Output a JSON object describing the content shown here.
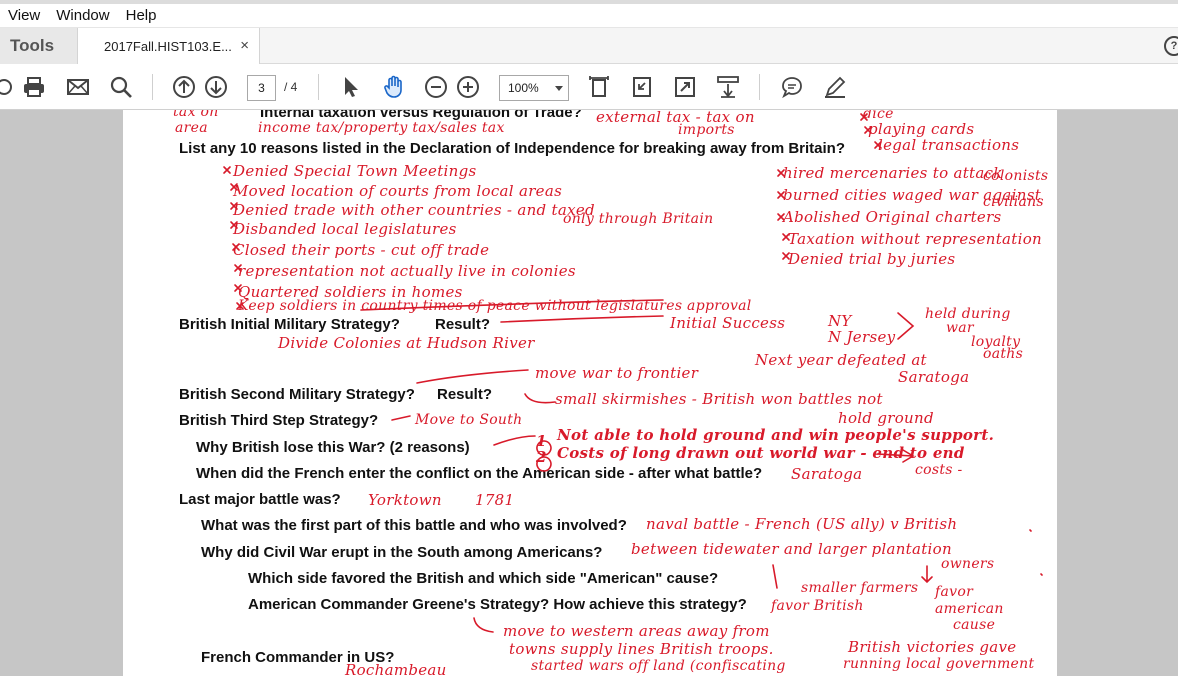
{
  "menu": [
    "View",
    "Window",
    "Help"
  ],
  "tabs": {
    "tools": "Tools",
    "document": "2017Fall.HIST103.E...",
    "close": "×",
    "help": "?"
  },
  "toolbar": {
    "page_current": "3",
    "page_sep": "/ 4",
    "zoom": "100%"
  },
  "icons": [
    "print-icon",
    "email-icon",
    "search-icon",
    "page-up-icon",
    "page-down-icon",
    "select-arrow-icon",
    "hand-tool-icon",
    "zoom-out-icon",
    "zoom-in-icon",
    "fit-page-icon",
    "rotate-icon",
    "full-screen-icon",
    "scroll-mode-icon",
    "comment-icon",
    "highlight-pen-icon"
  ],
  "questions": [
    "Internal taxation versus Regulation of Trade?",
    "List any 10 reasons listed in the Declaration of Independence for breaking away from Britain?",
    "British Initial Military Strategy?",
    "Result?",
    "British Second Military Strategy?",
    "Result?",
    "British Third Step Strategy?",
    "Why British lose this War?  (2 reasons)",
    "When did the French enter the conflict on the American side - after what battle?",
    "Last major battle was?",
    "What was the first part of this battle and who was involved?",
    "Why did Civil War erupt in the South among Americans?",
    "Which side favored the British and which side \"American\" cause?",
    "American Commander Greene's Strategy?   How achieve this strategy?",
    "French Commander in US?"
  ],
  "notes": {
    "n1": "tax on",
    "n2": "area",
    "n3": "income tax/property tax/sales tax",
    "n4": "external tax - tax on",
    "n5": "imports",
    "n6": "dice",
    "n7": "playing cards",
    "n8": "legal transactions",
    "r1": "Denied Special Town Meetings",
    "r2": "Moved location of courts from local areas",
    "r3": "Denied trade with other countries - and taxed",
    "r3b": "only through Britain",
    "r4": "Disbanded local legislatures",
    "r5": "Closed their ports - cut off trade",
    "r6": "representation not actually live in colonies",
    "r7": "Quartered soldiers in homes",
    "r8": "Keep soldiers in country times of peace without legislatures approval",
    "r9": "hired mercenaries to attack",
    "r9b": "colonists",
    "r10": "burned cities waged war against",
    "r10b": "civilians",
    "r11": "Abolished Original charters",
    "r12": "Taxation without representation",
    "r13": "Denied trial by juries",
    "m1": "Initial Success",
    "m2": "NY",
    "m3": "N Jersey",
    "m4": "held during",
    "m5": "war",
    "m6": "loyalty",
    "m7": "oaths",
    "m8": "Divide Colonies at Hudson River",
    "m9": "Next year defeated at",
    "m10": "Saratoga",
    "m11": "move war to frontier",
    "m12": "small skirmishes - British won battles not",
    "m13": "hold ground",
    "m14": "Move to South",
    "w1": "Not able to hold ground and win people's support.",
    "w2": "Costs of long drawn out world war - end to end",
    "w3": "costs -",
    "w1n": "1",
    "w2n": "2",
    "f1": "Saratoga",
    "l1": "Yorktown",
    "l2": "1781",
    "p1": "naval battle - French (US ally) v British",
    "c1": "between tidewater and larger plantation",
    "c2": "owners",
    "s1": "smaller farmers",
    "s2": "favor British",
    "s3": "favor",
    "s4": "american",
    "s5": "cause",
    "g1": "move to western areas away from",
    "g2": "towns supply lines British troops.",
    "g3": "British victories gave",
    "g4": "started wars off land (confiscating",
    "g5": "running local government",
    "fc": "Rochambeau"
  }
}
